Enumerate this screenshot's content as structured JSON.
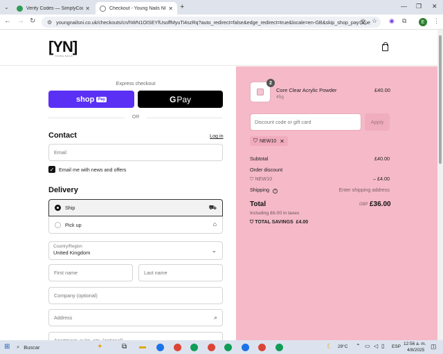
{
  "browser": {
    "tabs": [
      {
        "title": "Verify Codes — SimplyCodes",
        "active": false,
        "favicon_color": "#2e9d58"
      },
      {
        "title": "Checkout - Young Nails NI",
        "active": true,
        "favicon_color": "#777777"
      }
    ],
    "url": "youngnailsni.co.uk/checkouts/cn/hWN1OISEYfUsoffMyuTi4szRq?auto_redirect=false&edge_redirect=true&locale=en-GB&skip_shop_pay=true",
    "profile_initial": "E"
  },
  "store": {
    "logo_text": "[YN]",
    "logo_subtext": "YOUNG NAILS"
  },
  "checkout": {
    "express_label": "Express checkout",
    "shop_pay_label": "shop",
    "shop_pay_badge": "Pay",
    "gpay_label": "Pay",
    "or_label": "OR",
    "contact": {
      "heading": "Contact",
      "login_link": "Log in",
      "email_placeholder": "Email",
      "newsletter_label": "Email me with news and offers",
      "newsletter_checked": true
    },
    "delivery": {
      "heading": "Delivery",
      "options": [
        {
          "label": "Ship",
          "selected": true,
          "icon": "truck-icon"
        },
        {
          "label": "Pick up",
          "selected": false,
          "icon": "store-icon"
        }
      ],
      "country_label": "Country/Region",
      "country_value": "United Kingdom",
      "first_name_placeholder": "First name",
      "last_name_placeholder": "Last name",
      "company_placeholder": "Company (optional)",
      "address_placeholder": "Address",
      "apartment_placeholder": "Apartment, suite, etc. (optional)"
    }
  },
  "summary": {
    "item": {
      "name": "Core Clear Acrylic Powder",
      "variant": "45g",
      "price": "£40.00",
      "quantity": "2"
    },
    "discount_placeholder": "Discount code or gift card",
    "apply_label": "Apply",
    "applied_code": "NEW10",
    "subtotal_label": "Subtotal",
    "subtotal_value": "£40.00",
    "order_discount_label": "Order discount",
    "discount_code": "NEW10",
    "discount_value": "– £4.00",
    "shipping_label": "Shipping",
    "shipping_value": "Enter shipping address",
    "total_label": "Total",
    "currency": "GBP",
    "total_value": "£36.00",
    "taxes_note": "Including £6.00 in taxes",
    "savings_label": "TOTAL SAVINGS",
    "savings_value": "£4.00",
    "panel_color": "#f5b9c8"
  },
  "taskbar": {
    "search_placeholder": "Buscar",
    "temperature": "29°C",
    "language": "ESP",
    "time": "12:56 a. m.",
    "date": "4/8/2025",
    "notifications": "1"
  }
}
